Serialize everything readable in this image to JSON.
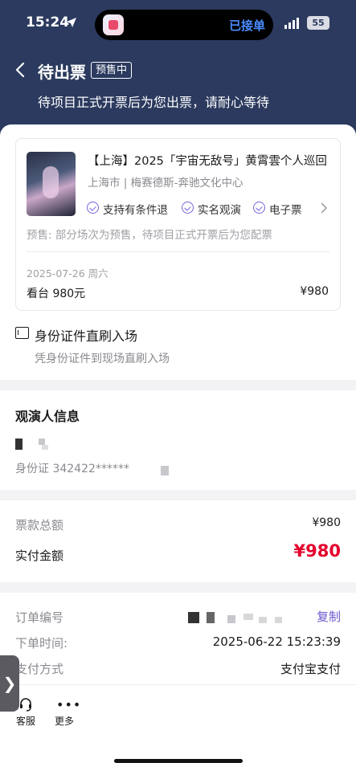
{
  "status_bar": {
    "time": "15:24",
    "island_text": "已接单",
    "battery": "55"
  },
  "header": {
    "title": "待出票",
    "badge": "预售中",
    "subtitle": "待项目正式开票后为您出票，请耐心等待"
  },
  "event": {
    "title": "【上海】2025「宇宙无敌号」黄霄雲个人巡回",
    "venue": "上海市 | 梅赛德斯-奔驰文化中心",
    "features": [
      "支持有条件退",
      "实名观演",
      "电子票"
    ],
    "presale_note": "预售: 部分场次为预售，待项目正式开票后为您配票",
    "date": "2025-07-26 周六",
    "ticket_tier": "看台 980元",
    "ticket_price": "¥980"
  },
  "entry": {
    "title": "身份证件直刷入场",
    "subtitle": "凭身份证件到现场直刷入场"
  },
  "audience": {
    "title": "观演人信息",
    "id_label": "身份证  342422******"
  },
  "amounts": {
    "total_label": "票款总额",
    "total_value": "¥980",
    "paid_label": "实付金额",
    "paid_value": "¥980"
  },
  "order": {
    "number_label": "订单编号",
    "copy_label": "复制",
    "time_label": "下单时间:",
    "time_value": "2025-06-22 15:23:39",
    "pay_label": "支付方式",
    "pay_value": "支付宝支付"
  },
  "bottom": {
    "service_label": "客服",
    "more_label": "更多",
    "side_tab": "❯"
  },
  "colors": {
    "header_bg": "#2b3a5e",
    "accent": "#7b62d9",
    "price_red": "#e4002b"
  }
}
